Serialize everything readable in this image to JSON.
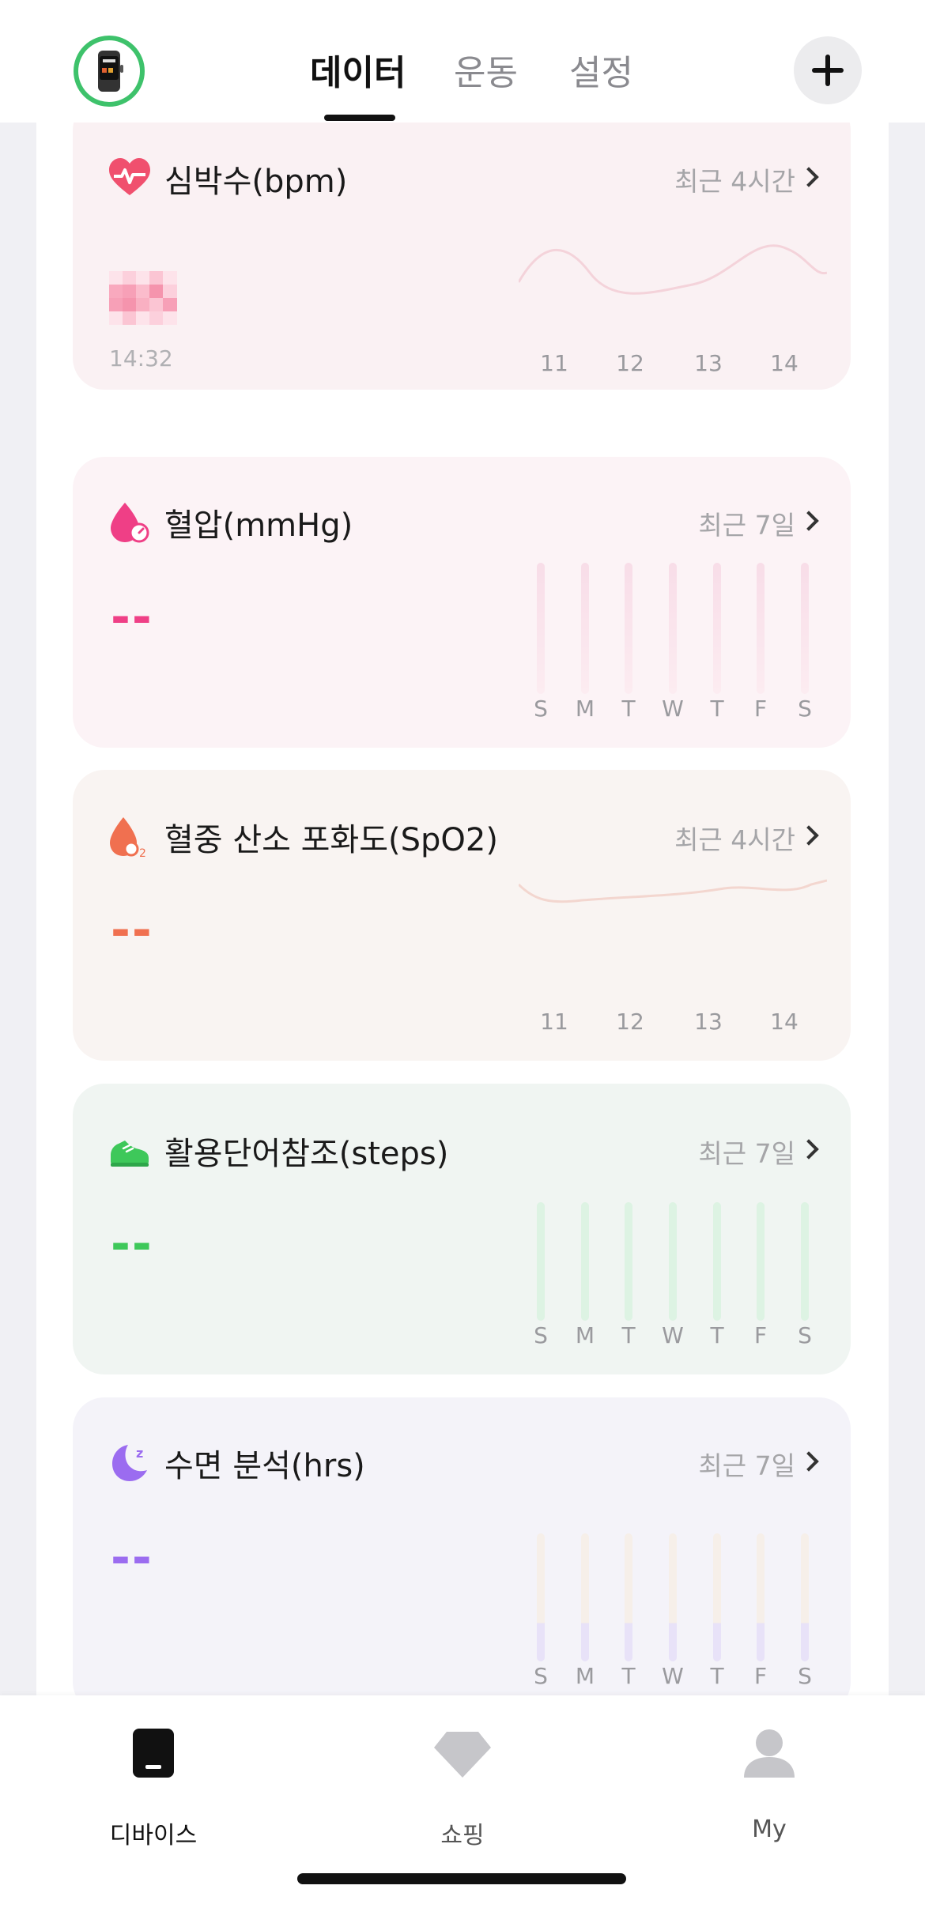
{
  "header": {
    "tabs": [
      {
        "label": "데이터",
        "active": true
      },
      {
        "label": "운동",
        "active": false
      },
      {
        "label": "설정",
        "active": false
      }
    ],
    "device_battery_color": "#3ec26b"
  },
  "cards": {
    "heart_rate": {
      "title": "심박수(bpm)",
      "range": "최근 4시간",
      "time": "14:32",
      "x_ticks": [
        "11",
        "12",
        "13",
        "14"
      ],
      "accent": "#f0506e",
      "background": "#faf1f3"
    },
    "blood_pressure": {
      "title": "혈압(mmHg)",
      "range": "최근 7일",
      "value": "--",
      "x_ticks": [
        "S",
        "M",
        "T",
        "W",
        "T",
        "F",
        "S"
      ],
      "accent": "#ef3f86",
      "background": "#fcf3f6"
    },
    "spo2": {
      "title": "혈중 산소 포화도(SpO2)",
      "range": "최근 4시간",
      "value": "--",
      "x_ticks": [
        "11",
        "12",
        "13",
        "14"
      ],
      "accent": "#f07050",
      "background": "#f9f4f2"
    },
    "steps": {
      "title": "활용단어참조(steps)",
      "range": "최근 7일",
      "value": "--",
      "x_ticks": [
        "S",
        "M",
        "T",
        "W",
        "T",
        "F",
        "S"
      ],
      "accent": "#3ec85a",
      "background": "#f0f5f2"
    },
    "sleep": {
      "title": "수면 분석(hrs)",
      "range": "최근 7일",
      "value": "--",
      "x_ticks": [
        "S",
        "M",
        "T",
        "W",
        "T",
        "F",
        "S"
      ],
      "accent": "#9b6cf0",
      "background": "#f4f3f9"
    }
  },
  "bottom_nav": {
    "items": [
      {
        "label": "디바이스",
        "active": true
      },
      {
        "label": "쇼핑",
        "active": false
      },
      {
        "label": "My",
        "active": false
      }
    ]
  }
}
